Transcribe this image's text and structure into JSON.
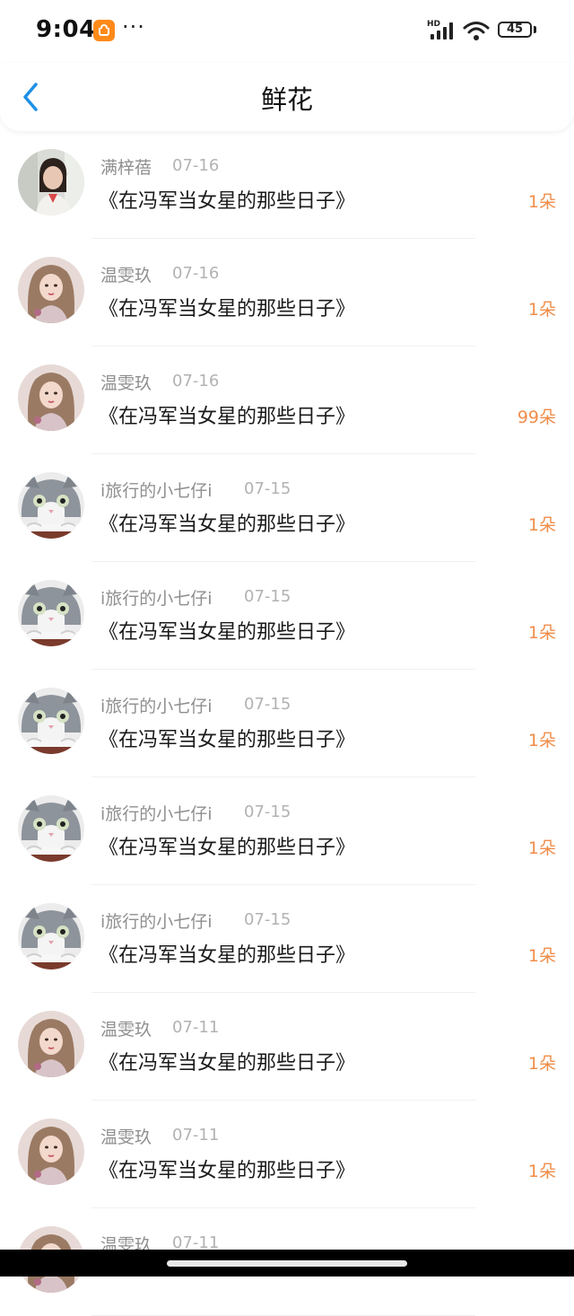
{
  "status_bar": {
    "time": "9:04",
    "more": "···",
    "network": "HD",
    "battery": "45",
    "icons": [
      "shopping-app-icon",
      "signal-icon",
      "wifi-icon",
      "battery-icon"
    ]
  },
  "nav": {
    "title": "鲜花",
    "back_icon": "chevron-left-icon"
  },
  "colors": {
    "accent_blue": "#1e90e6",
    "flower_count": "#f08d4a",
    "name_gray": "#8f8f8f",
    "date_gray": "#b2b2b2"
  },
  "items": [
    {
      "name": "满梓蓓",
      "date": "07-16",
      "book": "《在冯军当女星的那些日子》",
      "count": "1朵",
      "avatar": "woman-avatar-1"
    },
    {
      "name": "温雯玖",
      "date": "07-16",
      "book": "《在冯军当女星的那些日子》",
      "count": "1朵",
      "avatar": "woman-avatar-2"
    },
    {
      "name": "温雯玖",
      "date": "07-16",
      "book": "《在冯军当女星的那些日子》",
      "count": "99朵",
      "avatar": "woman-avatar-2"
    },
    {
      "name": "i旅行的小七仔i",
      "date": "07-15",
      "book": "《在冯军当女星的那些日子》",
      "count": "1朵",
      "avatar": "cat-avatar"
    },
    {
      "name": "i旅行的小七仔i",
      "date": "07-15",
      "book": "《在冯军当女星的那些日子》",
      "count": "1朵",
      "avatar": "cat-avatar"
    },
    {
      "name": "i旅行的小七仔i",
      "date": "07-15",
      "book": "《在冯军当女星的那些日子》",
      "count": "1朵",
      "avatar": "cat-avatar"
    },
    {
      "name": "i旅行的小七仔i",
      "date": "07-15",
      "book": "《在冯军当女星的那些日子》",
      "count": "1朵",
      "avatar": "cat-avatar"
    },
    {
      "name": "i旅行的小七仔i",
      "date": "07-15",
      "book": "《在冯军当女星的那些日子》",
      "count": "1朵",
      "avatar": "cat-avatar"
    },
    {
      "name": "温雯玖",
      "date": "07-11",
      "book": "《在冯军当女星的那些日子》",
      "count": "1朵",
      "avatar": "woman-avatar-2"
    },
    {
      "name": "温雯玖",
      "date": "07-11",
      "book": "《在冯军当女星的那些日子》",
      "count": "1朵",
      "avatar": "woman-avatar-2"
    },
    {
      "name": "温雯玖",
      "date": "07-11",
      "book": "",
      "count": "",
      "avatar": "woman-avatar-2"
    }
  ]
}
